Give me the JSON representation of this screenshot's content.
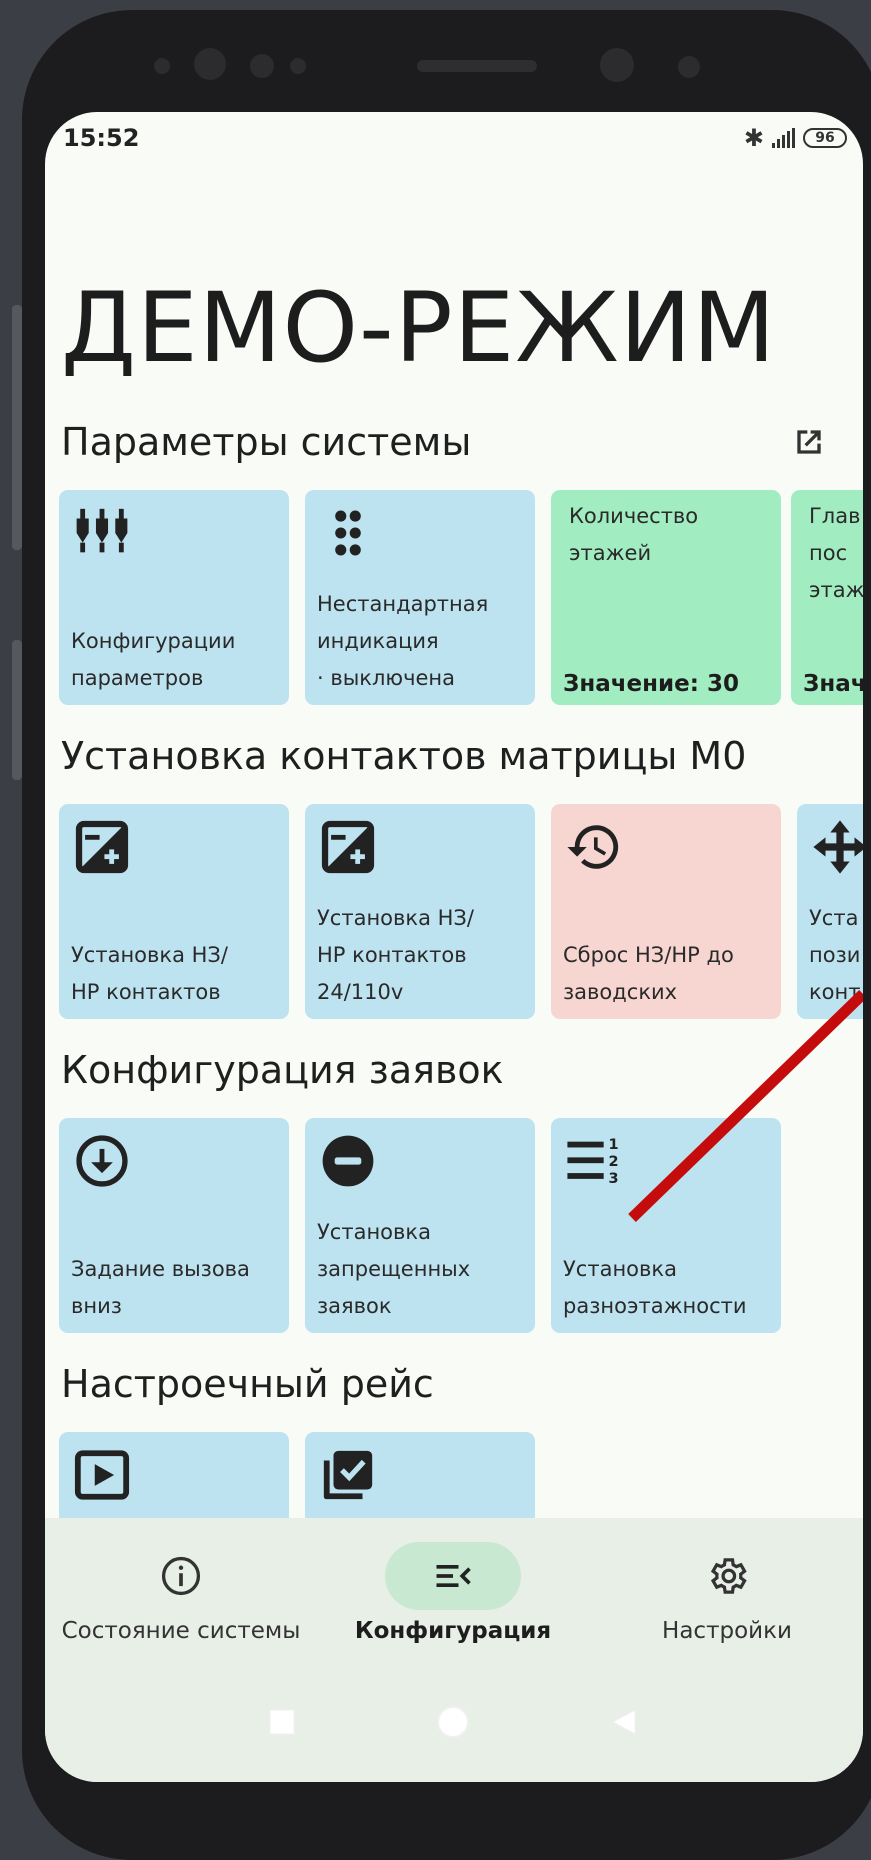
{
  "status_bar": {
    "time": "15:52",
    "battery": "96"
  },
  "page_title": "ДЕМО-РЕЖИМ",
  "sections": [
    {
      "title": "Параметры системы",
      "tiles": [
        {
          "label": "Конфигурации\nпараметров",
          "icon": "sliders-icon"
        },
        {
          "label": "Нестандартная\nиндикация\n· выключена",
          "icon": "dots-grid-icon"
        },
        {
          "top_text": "Количество\nэтажей",
          "value": "Значение: 30"
        },
        {
          "top_text": "Глав\nпос\nэтаж",
          "value": "Знач"
        }
      ]
    },
    {
      "title": "Установка контактов матрицы М0",
      "tiles": [
        {
          "label": "Установка НЗ/\nНР контактов",
          "icon": "plus-minus-icon"
        },
        {
          "label": "Установка НЗ/\nНР контактов\n24/110v",
          "icon": "plus-minus-icon"
        },
        {
          "label": "Сброс НЗ/НР до\nзаводских",
          "icon": "history-icon"
        },
        {
          "label": "Уста\nпози\nконт",
          "icon": "move-icon"
        }
      ]
    },
    {
      "title": "Конфигурация заявок",
      "tiles": [
        {
          "label": "Задание вызова\nвниз",
          "icon": "arrow-down-circle-icon"
        },
        {
          "label": "Установка\nзапрещенных\nзаявок",
          "icon": "minus-circle-icon"
        },
        {
          "label": "Установка\nразноэтажности",
          "icon": "numbered-list-icon"
        }
      ]
    },
    {
      "title": "Настроечный рейс",
      "tiles": [
        {
          "label": "",
          "icon": "play-box-icon"
        },
        {
          "label": "",
          "icon": "library-check-icon"
        }
      ]
    }
  ],
  "bottom_nav": [
    {
      "label": "Состояние системы",
      "icon": "info-icon",
      "active": false
    },
    {
      "label": "Конфигурация",
      "icon": "menu-open-icon",
      "active": true
    },
    {
      "label": "Настройки",
      "icon": "gear-icon",
      "active": false
    }
  ]
}
